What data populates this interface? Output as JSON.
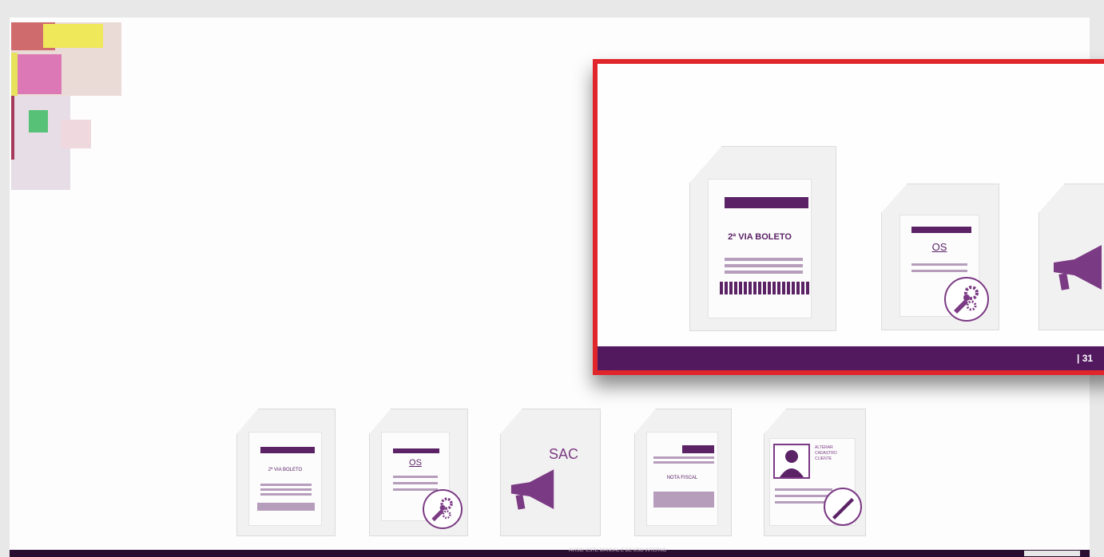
{
  "callout": {
    "icons": [
      {
        "label": "2ª VIA BOLETO"
      },
      {
        "label": "OS"
      },
      {
        "label": ""
      }
    ],
    "page_number": "| 31"
  },
  "bottom_icons": [
    {
      "label": "2ª VIA BOLETO"
    },
    {
      "label": "OS"
    },
    {
      "label": "SAC"
    },
    {
      "label": "NOTA FISCAL"
    },
    {
      "label": "ALTERAR CADASTRO CLIENTE"
    }
  ],
  "footer_strip": {
    "text": "AVISO: ESTE MANUAL E DE USO INTERNO"
  },
  "colors": {
    "brand_purple": "#53195f",
    "highlight_red": "#e1262b"
  },
  "icon_names": [
    "document-icon",
    "gears-icon",
    "megaphone-icon",
    "user-card-icon",
    "pen-icon"
  ]
}
